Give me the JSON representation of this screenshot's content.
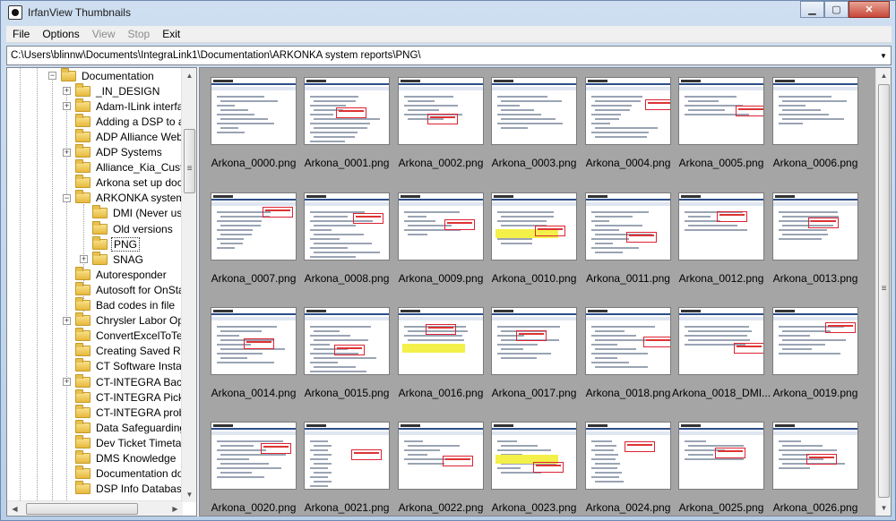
{
  "window": {
    "title": "IrfanView Thumbnails"
  },
  "caption": {
    "minimize": "▁",
    "maximize": "▢",
    "close": "✕"
  },
  "menu": [
    {
      "label": "File",
      "enabled": true
    },
    {
      "label": "Options",
      "enabled": true
    },
    {
      "label": "View",
      "enabled": false
    },
    {
      "label": "Stop",
      "enabled": false
    },
    {
      "label": "Exit",
      "enabled": true
    }
  ],
  "path": "C:\\Users\\blinnw\\Documents\\IntegraLink1\\Documentation\\ARKONKA system reports\\PNG\\",
  "tree": [
    {
      "label": "Documentation",
      "level": 0,
      "expander": "minus"
    },
    {
      "label": "_IN_DESIGN",
      "level": 1,
      "expander": "plus"
    },
    {
      "label": "Adam-ILink interface",
      "level": 1,
      "expander": "plus"
    },
    {
      "label": "Adding a DSP to a d",
      "level": 1,
      "expander": "none"
    },
    {
      "label": "ADP Alliance Web E",
      "level": 1,
      "expander": "none"
    },
    {
      "label": "ADP Systems",
      "level": 1,
      "expander": "plus"
    },
    {
      "label": "Alliance_Kia_Custo",
      "level": 1,
      "expander": "none"
    },
    {
      "label": "Arkona set up docu",
      "level": 1,
      "expander": "none"
    },
    {
      "label": "ARKONKA system r",
      "level": 1,
      "expander": "minus"
    },
    {
      "label": "DMI (Never use",
      "level": 2,
      "expander": "none"
    },
    {
      "label": "Old versions",
      "level": 2,
      "expander": "none"
    },
    {
      "label": "PNG",
      "level": 2,
      "expander": "none",
      "selected": true
    },
    {
      "label": "SNAG",
      "level": 2,
      "expander": "plus"
    },
    {
      "label": "Autoresponder",
      "level": 1,
      "expander": "none"
    },
    {
      "label": "Autosoft for OnStat",
      "level": 1,
      "expander": "none"
    },
    {
      "label": "Bad codes in file",
      "level": 1,
      "expander": "none"
    },
    {
      "label": "Chrysler Labor Ope",
      "level": 1,
      "expander": "plus"
    },
    {
      "label": "ConvertExcelToTex",
      "level": 1,
      "expander": "none"
    },
    {
      "label": "Creating Saved Rep",
      "level": 1,
      "expander": "none"
    },
    {
      "label": "CT Software Installa",
      "level": 1,
      "expander": "none"
    },
    {
      "label": "CT-INTEGRA Backg",
      "level": 1,
      "expander": "plus"
    },
    {
      "label": "CT-INTEGRA Pick C",
      "level": 1,
      "expander": "none"
    },
    {
      "label": "CT-INTEGRA proble",
      "level": 1,
      "expander": "none"
    },
    {
      "label": "Data Safeguarding",
      "level": 1,
      "expander": "none"
    },
    {
      "label": "Dev Ticket Timetab",
      "level": 1,
      "expander": "none"
    },
    {
      "label": "DMS Knowledge",
      "level": 1,
      "expander": "none"
    },
    {
      "label": "Documentation do",
      "level": 1,
      "expander": "none"
    },
    {
      "label": "DSP Info Database",
      "level": 1,
      "expander": "none"
    }
  ],
  "thumbnails": [
    "Arkona_0000.png",
    "Arkona_0001.png",
    "Arkona_0002.png",
    "Arkona_0003.png",
    "Arkona_0004.png",
    "Arkona_0005.png",
    "Arkona_0006.png",
    "Arkona_0007.png",
    "Arkona_0008.png",
    "Arkona_0009.png",
    "Arkona_0010.png",
    "Arkona_0011.png",
    "Arkona_0012.png",
    "Arkona_0013.png",
    "Arkona_0014.png",
    "Arkona_0015.png",
    "Arkona_0016.png",
    "Arkona_0017.png",
    "Arkona_0018.png",
    "Arkona_0018_DMI...",
    "Arkona_0019.png",
    "Arkona_0020.png",
    "Arkona_0021.png",
    "Arkona_0022.png",
    "Arkona_0023.png",
    "Arkona_0024.png",
    "Arkona_0025.png",
    "Arkona_0026.png"
  ],
  "scroll": {
    "up": "▲",
    "down": "▼",
    "left": "◀",
    "right": "▶",
    "grip": "≡"
  }
}
